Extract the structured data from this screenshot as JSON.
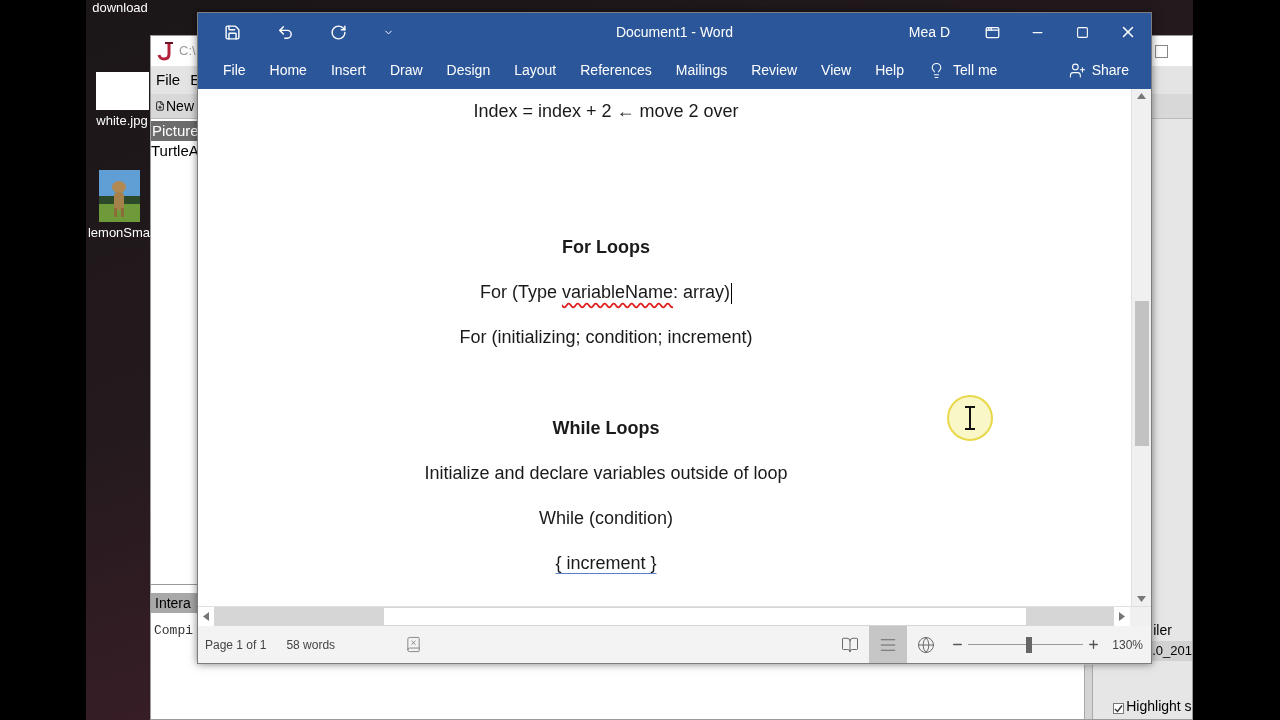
{
  "desktop": {
    "icons": [
      {
        "label": "download",
        "kind": "none"
      },
      {
        "label": "white.jpg",
        "kind": "blank"
      },
      {
        "label": "lemonSma"
      }
    ]
  },
  "java_window": {
    "title": "C:\\",
    "menu": [
      "File",
      "E"
    ],
    "toolbar": [
      "New"
    ],
    "panel_header": "Picture",
    "files": [
      "TurtleA"
    ],
    "bottom_tab": "Intera",
    "console": "Compi",
    "side_label": "iler",
    "side_value": ".0_201",
    "option": {
      "label": "Highlight s",
      "checked": true
    }
  },
  "word": {
    "title": "Document1 - Word",
    "user": "Mea D",
    "tabs": [
      {
        "label": "File",
        "selected": false
      },
      {
        "label": "Home",
        "selected": false
      },
      {
        "label": "Insert",
        "selected": false
      },
      {
        "label": "Draw",
        "selected": false
      },
      {
        "label": "Design",
        "selected": false
      },
      {
        "label": "Layout",
        "selected": false
      },
      {
        "label": "References",
        "selected": false
      },
      {
        "label": "Mailings",
        "selected": false
      },
      {
        "label": "Review",
        "selected": false
      },
      {
        "label": "View",
        "selected": false
      },
      {
        "label": "Help",
        "selected": false
      }
    ],
    "tell_me": "Tell me",
    "share": "Share",
    "paragraphs": [
      {
        "kind": "text",
        "cursor": false,
        "segments": [
          {
            "text": "Index = index + 2 ← move 2 over",
            "misspelled": false,
            "flagged": false
          }
        ]
      },
      {
        "kind": "heading",
        "cursor": false,
        "segments": [
          {
            "text": "For Loops",
            "misspelled": false,
            "flagged": false
          }
        ]
      },
      {
        "kind": "text",
        "cursor": true,
        "segments": [
          {
            "text": "For (Type ",
            "misspelled": false,
            "flagged": false
          },
          {
            "text": "variableName",
            "misspelled": true,
            "flagged": false
          },
          {
            "text": ": array)",
            "misspelled": false,
            "flagged": false
          }
        ]
      },
      {
        "kind": "text",
        "cursor": false,
        "segments": [
          {
            "text": "For (initializing; condition; increment)",
            "misspelled": false,
            "flagged": false
          }
        ]
      },
      {
        "kind": "heading",
        "cursor": false,
        "segments": [
          {
            "text": "While Loops",
            "misspelled": false,
            "flagged": false
          }
        ]
      },
      {
        "kind": "text",
        "cursor": false,
        "segments": [
          {
            "text": "Initialize and declare variables outside of loop",
            "misspelled": false,
            "flagged": false
          }
        ]
      },
      {
        "kind": "text",
        "cursor": false,
        "segments": [
          {
            "text": "While (condition)",
            "misspelled": false,
            "flagged": false
          }
        ]
      },
      {
        "kind": "text",
        "cursor": false,
        "segments": [
          {
            "text": "{ increment }",
            "misspelled": false,
            "flagged": true
          }
        ]
      }
    ],
    "status": {
      "page": "Page 1 of 1",
      "words": "58 words",
      "views": [
        {
          "kind": "read",
          "selected": false
        },
        {
          "kind": "print",
          "selected": true
        },
        {
          "kind": "web",
          "selected": false
        }
      ],
      "zoom": {
        "level": 0.53,
        "reading": "130%"
      }
    }
  }
}
